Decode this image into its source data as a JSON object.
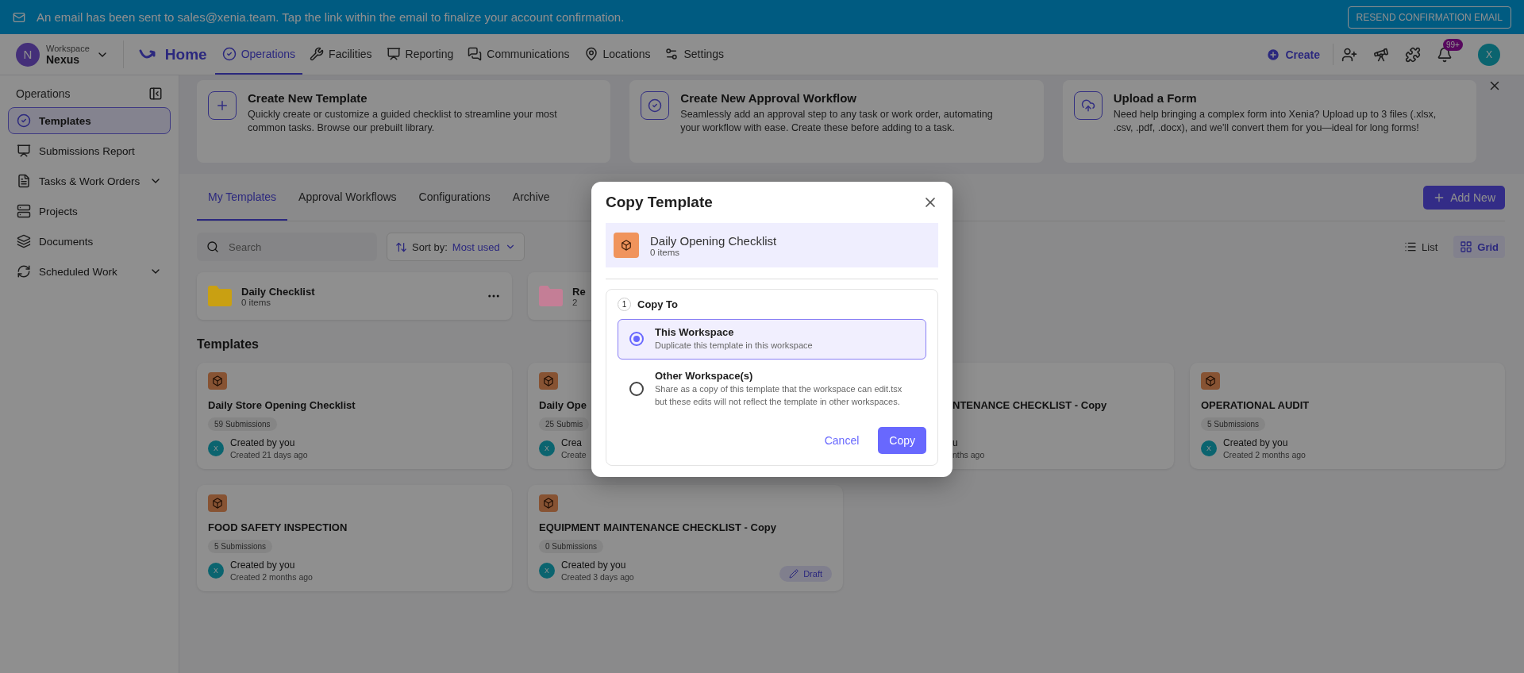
{
  "banner": {
    "message": "An email has been sent to sales@xenia.team. Tap the link within the email to finalize your account confirmation.",
    "button": "RESEND CONFIRMATION EMAIL"
  },
  "nav": {
    "workspace": {
      "initial": "N",
      "label": "Workspace",
      "name": "Nexus"
    },
    "home": "Home",
    "items": [
      {
        "label": "Operations",
        "selected": true
      },
      {
        "label": "Facilities",
        "selected": false
      },
      {
        "label": "Reporting",
        "selected": false
      },
      {
        "label": "Communications",
        "selected": false
      },
      {
        "label": "Locations",
        "selected": false
      },
      {
        "label": "Settings",
        "selected": false
      }
    ],
    "create": "Create",
    "notifications": "99+",
    "avatar": "X"
  },
  "sidebar": {
    "title": "Operations",
    "items": [
      {
        "label": "Templates",
        "selected": true,
        "expandable": false
      },
      {
        "label": "Submissions Report",
        "selected": false,
        "expandable": false
      },
      {
        "label": "Tasks & Work Orders",
        "selected": false,
        "expandable": true
      },
      {
        "label": "Projects",
        "selected": false,
        "expandable": false
      },
      {
        "label": "Documents",
        "selected": false,
        "expandable": false
      },
      {
        "label": "Scheduled Work",
        "selected": false,
        "expandable": true
      }
    ]
  },
  "info_cards": [
    {
      "title": "Create New Template",
      "text": "Quickly create or customize a guided checklist to streamline your most common tasks. Browse our prebuilt library."
    },
    {
      "title": "Create New Approval Workflow",
      "text": "Seamlessly add an approval step to any task or work order, automating your workflow with ease. Create these before adding to a task."
    },
    {
      "title": "Upload a Form",
      "text": "Need help bringing a complex form into Xenia? Upload up to 3 files (.xlsx, .csv, .pdf, .docx), and we'll convert them for you—ideal for long forms!"
    }
  ],
  "tabs": [
    {
      "label": "My Templates",
      "selected": true
    },
    {
      "label": "Approval Workflows",
      "selected": false
    },
    {
      "label": "Configurations",
      "selected": false
    },
    {
      "label": "Archive",
      "selected": false
    }
  ],
  "add_button": "Add New",
  "search": {
    "placeholder": "Search"
  },
  "sort": {
    "label": "Sort by:",
    "value": "Most used"
  },
  "views": [
    {
      "label": "List",
      "selected": false
    },
    {
      "label": "Grid",
      "selected": true
    }
  ],
  "folders": [
    {
      "kind": "full",
      "name": "Daily Checklist",
      "count": "0 items",
      "color": "#c9a012"
    },
    {
      "kind": "clipped",
      "name": "Re",
      "count": "2",
      "color": "#c47e96"
    }
  ],
  "templates_heading": "Templates",
  "templates": [
    {
      "kind": "full",
      "title": "Daily Store Opening Checklist",
      "submissions": "59 Submissions",
      "avatar": "X",
      "creator": "Created by you",
      "created": "Created 21 days ago"
    },
    {
      "kind": "right-hidden",
      "title": "Daily Ope",
      "submissions": "25 Submis",
      "avatar": "X",
      "creator": "Crea",
      "created": "Create"
    },
    {
      "kind": "left-hidden",
      "title": "NTENANCE CHECKLIST - Copy",
      "creator": "u",
      "created": "nths ago"
    },
    {
      "kind": "full",
      "title": "OPERATIONAL AUDIT",
      "submissions": "5 Submissions",
      "avatar": "X",
      "creator": "Created by you",
      "created": "Created 2 months ago"
    },
    {
      "kind": "full",
      "title": "FOOD SAFETY INSPECTION",
      "submissions": "5 Submissions",
      "avatar": "X",
      "creator": "Created by you",
      "created": "Created 2 months ago"
    },
    {
      "kind": "full",
      "title": "EQUIPMENT MAINTENANCE CHECKLIST - Copy",
      "submissions": "0 Submissions",
      "avatar": "X",
      "creator": "Created by you",
      "created": "Created 3 days ago",
      "status": "Draft"
    }
  ],
  "modal": {
    "title": "Copy Template",
    "template": {
      "name": "Daily Opening Checklist",
      "count": "0 items"
    },
    "step": "1",
    "section": "Copy To",
    "options": [
      {
        "title": "This Workspace",
        "description": "Duplicate this template in this workspace",
        "selected": true
      },
      {
        "title": "Other Workspace(s)",
        "description": "Share as a copy of this template that the workspace can edit.tsx but these edits will not reflect the template in other workspaces.",
        "selected": false
      }
    ],
    "cancel": "Cancel",
    "confirm": "Copy"
  }
}
